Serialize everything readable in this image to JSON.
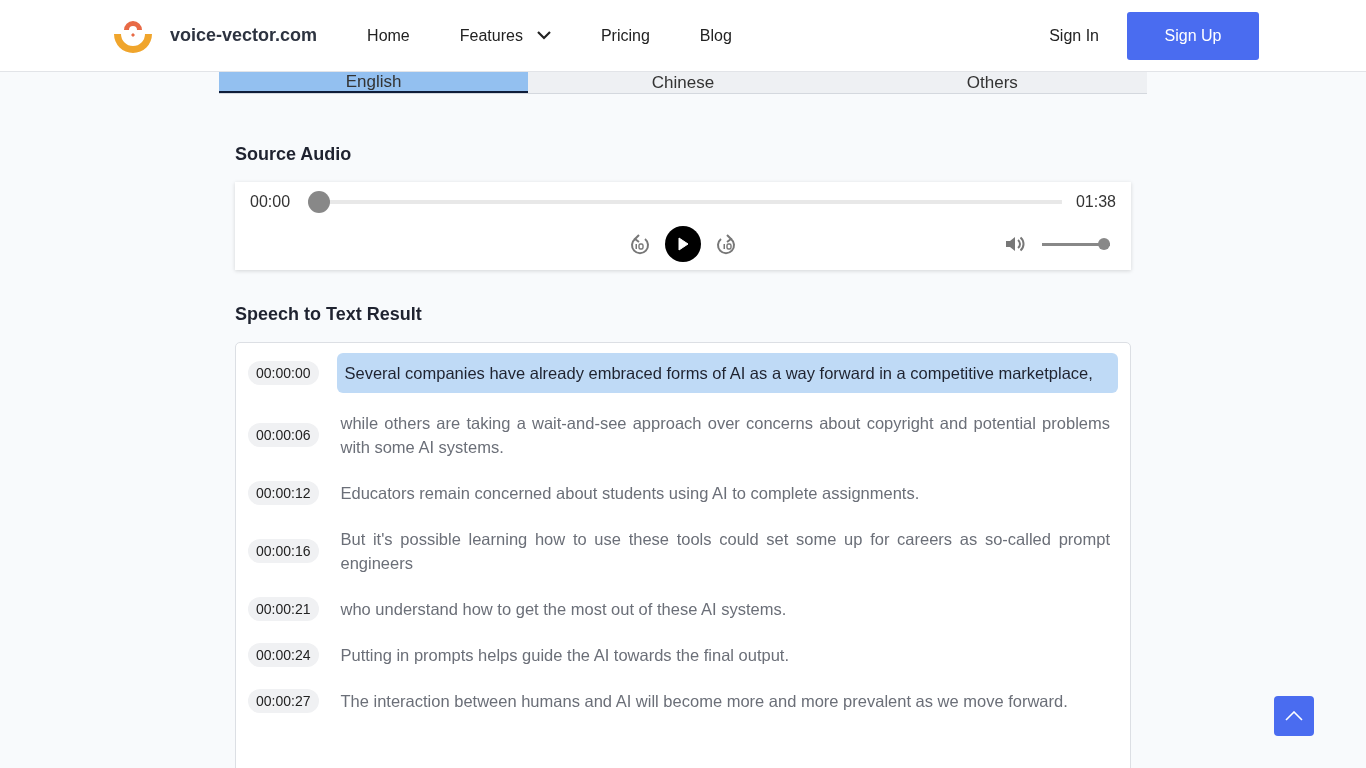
{
  "header": {
    "brand": "voice-vector.com",
    "nav": [
      {
        "label": "Home",
        "dropdown": false
      },
      {
        "label": "Features",
        "dropdown": true
      },
      {
        "label": "Pricing",
        "dropdown": false
      },
      {
        "label": "Blog",
        "dropdown": false
      }
    ],
    "sign_in": "Sign In",
    "sign_up": "Sign Up"
  },
  "tabs": [
    {
      "label": "English",
      "selected": true
    },
    {
      "label": "Chinese",
      "selected": false
    },
    {
      "label": "Others",
      "selected": false
    }
  ],
  "source_audio": {
    "title": "Source Audio",
    "current_time": "00:00",
    "duration": "01:38",
    "level": 0,
    "volume": {
      "level": 1
    }
  },
  "result": {
    "title": "Speech to Text Result",
    "segments": [
      {
        "time": "00:00:00",
        "text": "Several companies have already embraced forms of AI as a way forward in a competitive marketplace,",
        "selected": true
      },
      {
        "time": "00:00:06",
        "text": "while others are taking a wait-and-see approach over concerns about copyright and potential problems with some AI systems.",
        "selected": false
      },
      {
        "time": "00:00:12",
        "text": "Educators remain concerned about students using AI to complete assignments.",
        "selected": false
      },
      {
        "time": "00:00:16",
        "text": "But it's possible learning how to use these tools could set some up for careers as so-called prompt engineers",
        "selected": false
      },
      {
        "time": "00:00:21",
        "text": "who understand how to get the most out of these AI systems.",
        "selected": false
      },
      {
        "time": "00:00:24",
        "text": "Putting in prompts helps guide the AI towards the final output.",
        "selected": false
      },
      {
        "time": "00:00:27",
        "text": "The interaction between humans and AI will become more and more prevalent as we move forward.",
        "selected": false
      }
    ]
  }
}
